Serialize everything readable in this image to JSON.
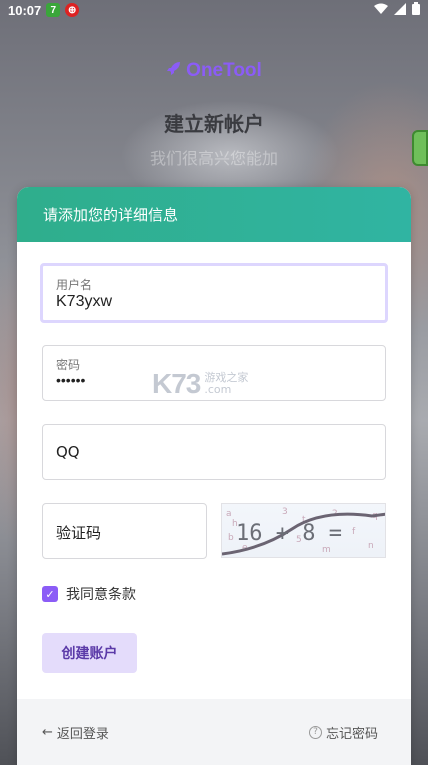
{
  "status_bar": {
    "time": "10:07",
    "badge1": "7",
    "badge2": "⑭"
  },
  "header": {
    "brand": "OneTool",
    "title": "建立新帐户",
    "subtitle": "我们很高兴您能加"
  },
  "card": {
    "heading": "请添加您的详细信息",
    "username": {
      "label": "用户名",
      "value": "K73yxw"
    },
    "password": {
      "label": "密码",
      "value": "••••••"
    },
    "qq": {
      "placeholder": "QQ"
    },
    "captcha": {
      "placeholder": "验证码",
      "image_text": "16 + 8 ="
    },
    "agree_label": "我同意条款",
    "agree_checked": true,
    "create_button": "创建账户",
    "footer": {
      "back_login": "返回登录",
      "forgot_password": "忘记密码"
    }
  },
  "watermark": {
    "main": "K73",
    "line1": "游戏之家",
    "line2": ".com"
  },
  "colors": {
    "accent": "#8b5cf6",
    "header_gradient_start": "#2fae8c",
    "header_gradient_end": "#30b4a2",
    "button_bg": "#e4dcfb"
  }
}
